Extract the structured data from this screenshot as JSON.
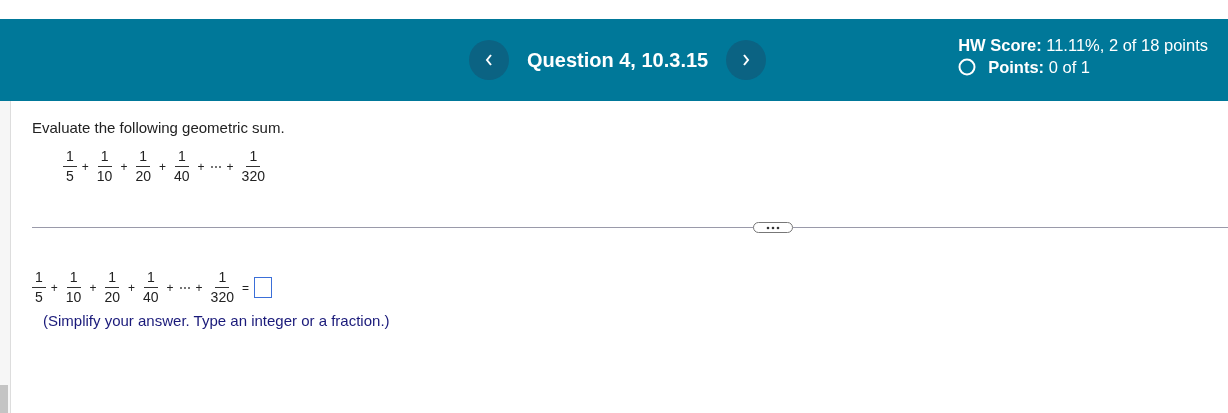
{
  "header": {
    "question": "Question 4, 10.3.15",
    "hw_score": {
      "label": "HW Score:",
      "value": "11.11%, 2 of 18 points"
    },
    "points": {
      "label": "Points:",
      "value": "0 of 1"
    }
  },
  "prompt": "Evaluate the following geometric sum.",
  "expression": [
    {
      "kind": "fraction",
      "numerator": "1",
      "denominator": "5"
    },
    {
      "kind": "operator",
      "text": "+"
    },
    {
      "kind": "fraction",
      "numerator": "1",
      "denominator": "10"
    },
    {
      "kind": "operator",
      "text": "+"
    },
    {
      "kind": "fraction",
      "numerator": "1",
      "denominator": "20"
    },
    {
      "kind": "operator",
      "text": "+"
    },
    {
      "kind": "fraction",
      "numerator": "1",
      "denominator": "40"
    },
    {
      "kind": "operator",
      "text": "+"
    },
    {
      "kind": "operator",
      "text": "⋯"
    },
    {
      "kind": "operator",
      "text": "+"
    },
    {
      "kind": "fraction",
      "numerator": "1",
      "denominator": "320"
    }
  ],
  "answer_expression": [
    {
      "kind": "fraction",
      "numerator": "1",
      "denominator": "5"
    },
    {
      "kind": "operator",
      "text": "+"
    },
    {
      "kind": "fraction",
      "numerator": "1",
      "denominator": "10"
    },
    {
      "kind": "operator",
      "text": "+"
    },
    {
      "kind": "fraction",
      "numerator": "1",
      "denominator": "20"
    },
    {
      "kind": "operator",
      "text": "+"
    },
    {
      "kind": "fraction",
      "numerator": "1",
      "denominator": "40"
    },
    {
      "kind": "operator",
      "text": "+"
    },
    {
      "kind": "operator",
      "text": "⋯"
    },
    {
      "kind": "operator",
      "text": "+"
    },
    {
      "kind": "fraction",
      "numerator": "1",
      "denominator": "320"
    },
    {
      "kind": "operator",
      "text": "="
    },
    {
      "kind": "answer"
    }
  ],
  "instruction": "(Simplify your answer. Type an integer or a fraction.)"
}
